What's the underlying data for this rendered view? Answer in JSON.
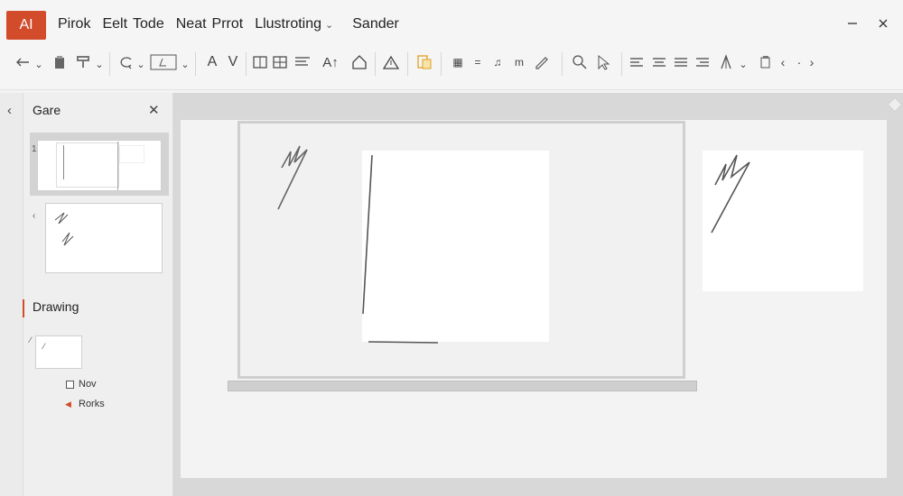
{
  "app": {
    "logo_text": "AI",
    "menu": [
      "Pirok",
      "Eelt",
      "Tode",
      "Neat",
      "Prrot",
      "Llustroting"
    ],
    "menu_extra": "Sander",
    "accent_color": "#d24b2b"
  },
  "window": {
    "minimize_icon": "minimize-icon",
    "close_icon": "close-icon"
  },
  "toolbar": {
    "text_tool_A": "A",
    "text_tool_V": "V",
    "text_size_label": "A↑",
    "icons": [
      "undo-icon",
      "paste-icon",
      "format-painter-icon",
      "lasso-icon",
      "select-rect-icon",
      "text-size-icon",
      "grid-icon",
      "table-icon",
      "home-shape-icon",
      "warning-icon",
      "highlight-icon",
      "list-icon",
      "pen-icon",
      "search-icon",
      "align-left-icon",
      "align-center-icon",
      "align-justify-icon",
      "align-right-icon",
      "shapes-icon",
      "more-icon"
    ]
  },
  "sidebar": {
    "title": "Gare",
    "section": "Drawing",
    "items": [
      {
        "label": "Nov",
        "type": "checkbox"
      },
      {
        "label": "Rorks",
        "type": "arrow"
      }
    ]
  }
}
